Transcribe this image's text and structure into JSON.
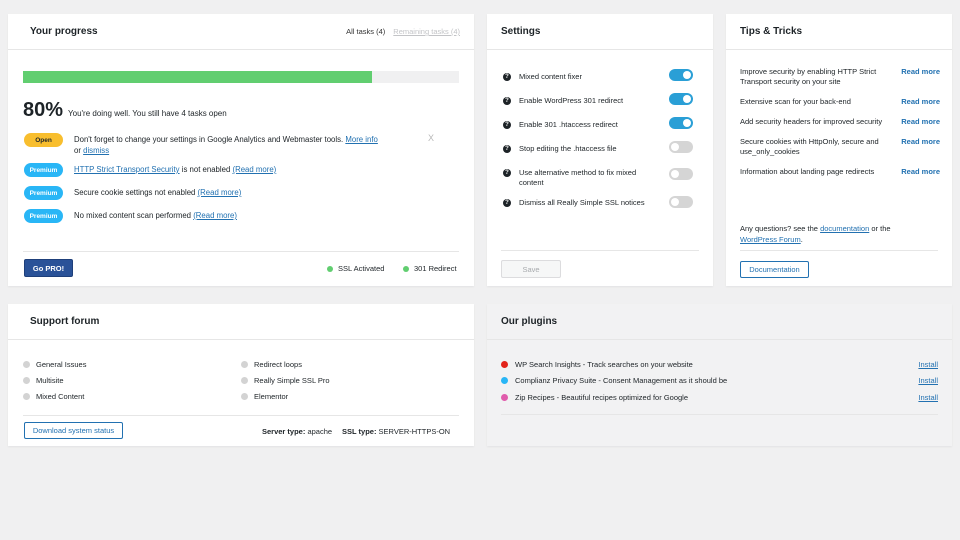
{
  "progress": {
    "title": "Your progress",
    "tab_all": "All tasks (4)",
    "tab_remaining": "Remaining tasks (4)",
    "percent": "80%",
    "percent_value": 0.8,
    "summary": "You're doing well. You still have 4 tasks open",
    "tasks": [
      {
        "badge": "Open",
        "text": "Don't forget to change your settings in Google Analytics and Webmaster tools.",
        "link1": "More info",
        "or": "or",
        "link2": "dismiss"
      },
      {
        "badge": "Premium",
        "link": "HTTP Strict Transport Security",
        "text": "is not enabled",
        "more": "(Read more)"
      },
      {
        "badge": "Premium",
        "text": "Secure cookie settings not enabled",
        "more": "(Read more)"
      },
      {
        "badge": "Premium",
        "text": "No mixed content scan performed",
        "more": "(Read more)"
      }
    ],
    "dismiss_x": "X",
    "gopro": "Go PRO!",
    "status1": "SSL Activated",
    "status2": "301 Redirect"
  },
  "settings": {
    "title": "Settings",
    "items": [
      {
        "label": "Mixed content fixer",
        "on": true
      },
      {
        "label": "Enable WordPress 301 redirect",
        "on": true
      },
      {
        "label": "Enable 301 .htaccess redirect",
        "on": true
      },
      {
        "label": "Stop editing the .htaccess file",
        "on": false
      },
      {
        "label": "Use alternative method to fix mixed content",
        "on": false
      },
      {
        "label": "Dismiss all Really Simple SSL notices",
        "on": false
      }
    ],
    "save": "Save"
  },
  "tips": {
    "title": "Tips & Tricks",
    "items": [
      {
        "text": "Improve security by enabling HTTP Strict Transport security on your site",
        "more": "Read more"
      },
      {
        "text": "Extensive scan for your back-end",
        "more": "Read more"
      },
      {
        "text": "Add security headers for improved security",
        "more": "Read more"
      },
      {
        "text": "Secure cookies with HttpOnly, secure and use_only_cookies",
        "more": "Read more"
      },
      {
        "text": "Information about landing page redirects",
        "more": "Read more"
      }
    ],
    "question_pre": "Any questions? see the",
    "question_link1": "documentation",
    "question_mid": "or the",
    "question_link2": "WordPress Forum",
    "question_end": ".",
    "doc_button": "Documentation"
  },
  "support": {
    "title": "Support forum",
    "col1": [
      "General Issues",
      "Multisite",
      "Mixed Content"
    ],
    "col2": [
      "Redirect loops",
      "Really Simple SSL Pro",
      "Elementor"
    ],
    "download": "Download system status",
    "server_label": "Server type:",
    "server_value": "apache",
    "ssl_label": "SSL type:",
    "ssl_value": "SERVER-HTTPS-ON"
  },
  "plugins": {
    "title": "Our plugins",
    "items": [
      {
        "name": "WP Search Insights - Track searches on your website",
        "color": "#e2241a",
        "install": "Install"
      },
      {
        "name": "Complianz Privacy Suite - Consent Management as it should be",
        "color": "#29b6f6",
        "install": "Install"
      },
      {
        "name": "Zip Recipes - Beautiful recipes optimized for Google",
        "color": "#e05cac",
        "install": "Install"
      }
    ]
  }
}
